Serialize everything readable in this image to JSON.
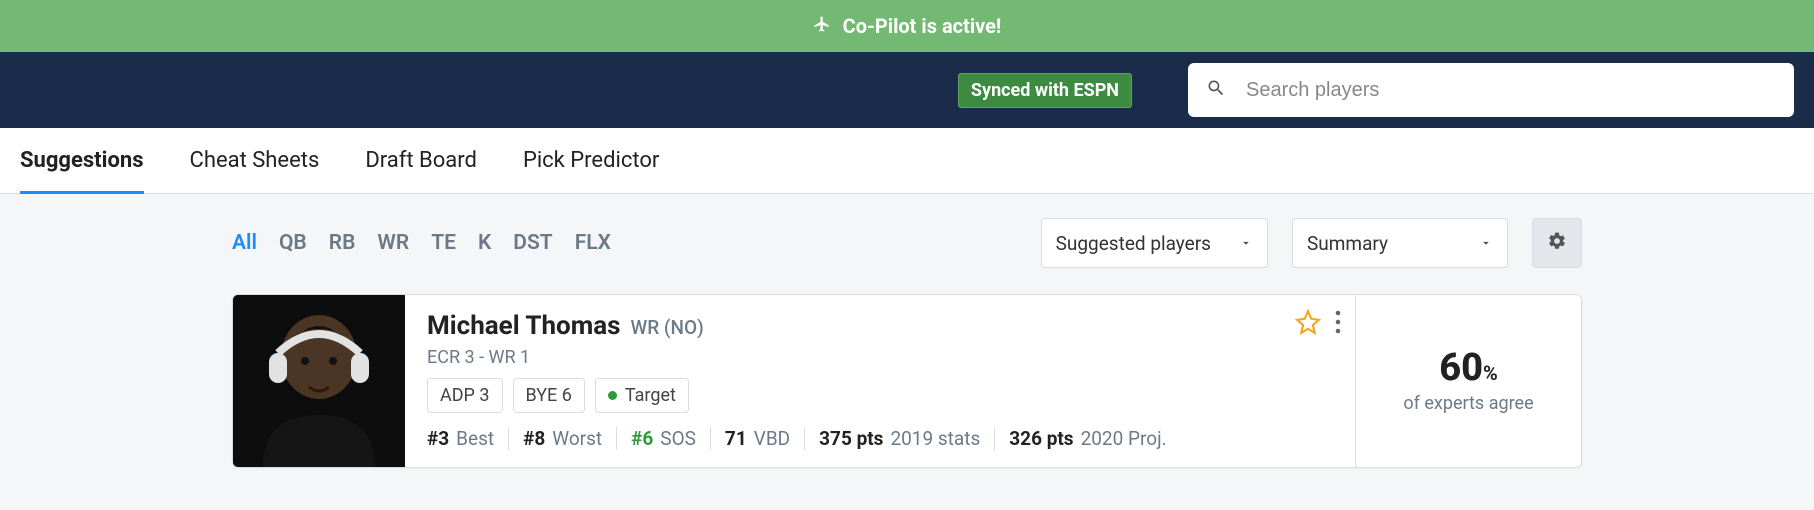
{
  "banner": {
    "text": "Co-Pilot is active!"
  },
  "header": {
    "sync_badge": "Synced with ESPN",
    "search_placeholder": "Search players"
  },
  "nav": {
    "items": [
      {
        "id": "suggestions",
        "label": "Suggestions",
        "active": true
      },
      {
        "id": "cheat-sheets",
        "label": "Cheat Sheets",
        "active": false
      },
      {
        "id": "draft-board",
        "label": "Draft Board",
        "active": false
      },
      {
        "id": "pick-predictor",
        "label": "Pick Predictor",
        "active": false
      }
    ]
  },
  "filters": {
    "positions": [
      "All",
      "QB",
      "RB",
      "WR",
      "TE",
      "K",
      "DST",
      "FLX"
    ],
    "active_position": "All",
    "dropdowns": {
      "view": "Suggested players",
      "mode": "Summary"
    }
  },
  "player": {
    "name": "Michael Thomas",
    "pos_team": "WR (NO)",
    "subline": "ECR 3 - WR 1",
    "chips": {
      "adp": "ADP 3",
      "bye": "BYE 6",
      "target": "Target"
    },
    "stats": {
      "best": {
        "v": "#3",
        "l": "Best"
      },
      "worst": {
        "v": "#8",
        "l": "Worst"
      },
      "sos": {
        "v": "#6",
        "l": "SOS"
      },
      "vbd": {
        "v": "71",
        "l": "VBD"
      },
      "prev": {
        "v": "375 pts",
        "l": "2019 stats"
      },
      "proj": {
        "v": "326 pts",
        "l": "2020 Proj."
      }
    },
    "consensus": {
      "pct": "60",
      "pct_suffix": "%",
      "label": "of experts agree"
    }
  }
}
